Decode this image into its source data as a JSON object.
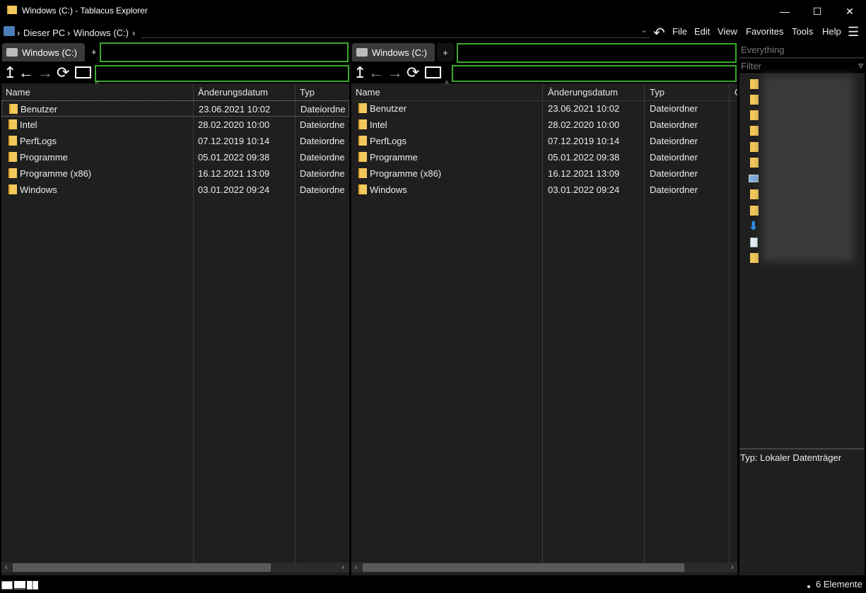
{
  "window": {
    "title": "Windows (C:) - Tablacus Explorer"
  },
  "address": {
    "crumbs": [
      "Dieser PC",
      "Windows (C:)"
    ]
  },
  "menu": [
    "File",
    "Edit",
    "View",
    "Favorites",
    "Tools",
    "Help"
  ],
  "panes": [
    {
      "tab_label": "Windows (C:)",
      "add_tab": "+",
      "columns": [
        "Name",
        "Änderungsdatum",
        "Typ"
      ],
      "rows": [
        {
          "name": "Benutzer",
          "date": "23.06.2021 10:02",
          "type": "Dateiordne"
        },
        {
          "name": "Intel",
          "date": "28.02.2020 10:00",
          "type": "Dateiordne"
        },
        {
          "name": "PerfLogs",
          "date": "07.12.2019 10:14",
          "type": "Dateiordne"
        },
        {
          "name": "Programme",
          "date": "05.01.2022 09:38",
          "type": "Dateiordne"
        },
        {
          "name": "Programme (x86)",
          "date": "16.12.2021 13:09",
          "type": "Dateiordne"
        },
        {
          "name": "Windows",
          "date": "03.01.2022 09:24",
          "type": "Dateiordne"
        }
      ]
    },
    {
      "tab_label": "Windows (C:)",
      "add_tab": "+",
      "columns": [
        "Name",
        "Änderungsdatum",
        "Typ",
        "G"
      ],
      "rows": [
        {
          "name": "Benutzer",
          "date": "23.06.2021 10:02",
          "type": "Dateiordner"
        },
        {
          "name": "Intel",
          "date": "28.02.2020 10:00",
          "type": "Dateiordner"
        },
        {
          "name": "PerfLogs",
          "date": "07.12.2019 10:14",
          "type": "Dateiordner"
        },
        {
          "name": "Programme",
          "date": "05.01.2022 09:38",
          "type": "Dateiordner"
        },
        {
          "name": "Programme (x86)",
          "date": "16.12.2021 13:09",
          "type": "Dateiordner"
        },
        {
          "name": "Windows",
          "date": "03.01.2022 09:24",
          "type": "Dateiordner"
        }
      ]
    }
  ],
  "sidebar": {
    "search_placeholder": "Everything",
    "filter_placeholder": "Filter",
    "info": "Typ: Lokaler Datenträger"
  },
  "status": {
    "count": "6 Elemente"
  },
  "colors": {
    "accent_green": "#3aa82a",
    "folder": "#f3c85a",
    "pane_bg": "#1f1f1f"
  }
}
